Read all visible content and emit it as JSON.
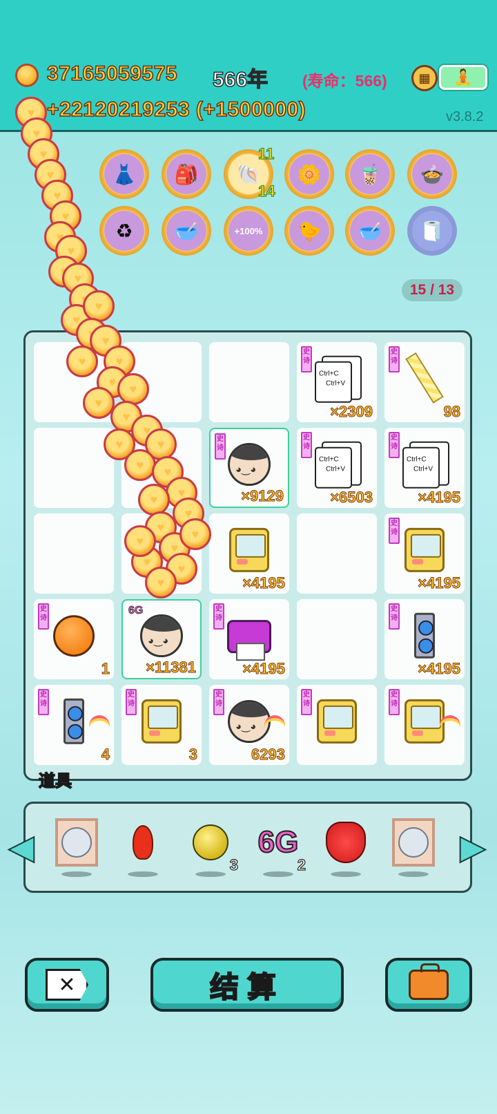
{
  "header": {
    "coins": "37165059575",
    "year": "566年",
    "lifespan": "(寿命：566)",
    "income": "+22120219253 (+1500000)",
    "version": "v3.8.2"
  },
  "badges": {
    "shell_top": "11",
    "shell_bottom": "14",
    "bonus": "+100%"
  },
  "page_counter": "15 / 13",
  "board": {
    "tag": "史诗",
    "ctrl_c": "Ctrl+C",
    "ctrl_v": "Ctrl+V",
    "counts": {
      "r0c2": "×2309",
      "r0c3": "98",
      "r1c1": "×9129",
      "r1c2": "×6503",
      "r1c3": "×4195",
      "r2c1": "×4195",
      "r2c3": "×4195",
      "r3c0": "1",
      "r3c1": "×11381",
      "r3c2": "×4195",
      "r3c4": "×4195",
      "r4c0": "4",
      "r4c1": "3",
      "r4c2": "6293"
    },
    "crown_label": "6G"
  },
  "tools": {
    "label": "道具",
    "gold_ball_count": "3",
    "sixg_text": "6G",
    "sixg_count": "2"
  },
  "buttons": {
    "settle": "结算"
  },
  "colors": {
    "accent": "#30cfc6",
    "gold": "#ffd23a",
    "epic_tag": "#c028b8"
  }
}
